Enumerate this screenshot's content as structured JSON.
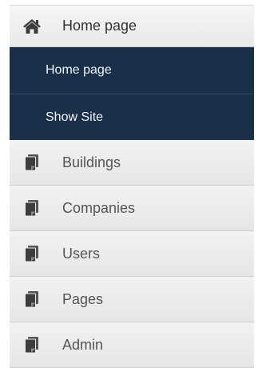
{
  "header": {
    "label": "Home page",
    "icon": "home-icon"
  },
  "submenu": {
    "items": [
      {
        "label": "Home page"
      },
      {
        "label": "Show Site"
      }
    ]
  },
  "menu": {
    "items": [
      {
        "label": "Buildings",
        "icon": "document-icon"
      },
      {
        "label": "Companies",
        "icon": "document-icon"
      },
      {
        "label": "Users",
        "icon": "document-icon"
      },
      {
        "label": "Pages",
        "icon": "document-icon"
      },
      {
        "label": "Admin",
        "icon": "document-icon"
      }
    ]
  },
  "colors": {
    "submenu_bg": "#1a3048",
    "menu_bg": "#ececec",
    "text": "#555555"
  }
}
